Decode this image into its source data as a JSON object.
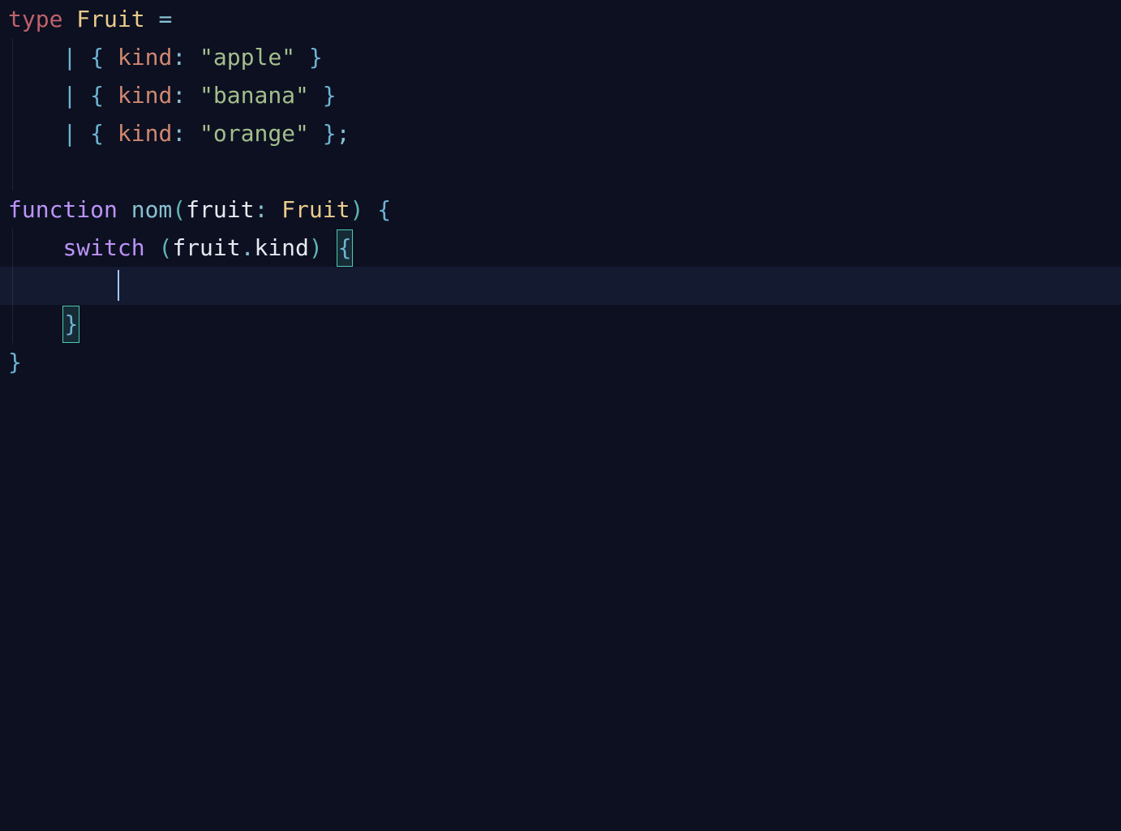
{
  "code": {
    "line1": {
      "kw": "type",
      "name": "Fruit",
      "eq": "="
    },
    "line2": {
      "pipe": "|",
      "lbrace": "{",
      "prop": "kind",
      "colon": ":",
      "str": "\"apple\"",
      "rbrace": "}"
    },
    "line3": {
      "pipe": "|",
      "lbrace": "{",
      "prop": "kind",
      "colon": ":",
      "str": "\"banana\"",
      "rbrace": "}"
    },
    "line4": {
      "pipe": "|",
      "lbrace": "{",
      "prop": "kind",
      "colon": ":",
      "str": "\"orange\"",
      "rbrace": "}",
      "semi": ";"
    },
    "line6": {
      "kw": "function",
      "fn": "nom",
      "lp": "(",
      "param": "fruit",
      "colon": ":",
      "type": "Fruit",
      "rp": ")",
      "lbrace": "{"
    },
    "line7": {
      "kw": "switch",
      "lp": "(",
      "obj": "fruit",
      "dot": ".",
      "mem": "kind",
      "rp": ")",
      "lbrace": "{"
    },
    "line9": {
      "rbrace": "}"
    },
    "line10": {
      "rbrace": "}"
    }
  }
}
